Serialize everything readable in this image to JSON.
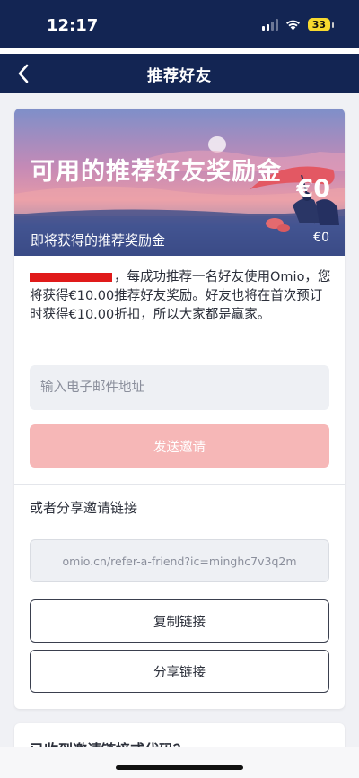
{
  "status_bar": {
    "time": "12:17",
    "battery": "33",
    "icons": [
      "signal-icon",
      "wifi-icon",
      "battery-icon"
    ]
  },
  "nav": {
    "title": "推荐好友",
    "back_icon": "chevron-left-icon"
  },
  "hero": {
    "title": "可用的推荐好友奖励金",
    "amount": "€0",
    "subtitle": "即将获得的推荐奖励金",
    "subamount": "€0"
  },
  "description": "，每成功推荐一名好友使用Omio，您将获得€10.00推荐好友奖励。好友也将在首次预订时获得€10.00折扣，所以大家都是赢家。",
  "email": {
    "placeholder": "输入电子邮件地址",
    "value": ""
  },
  "buttons": {
    "send": "发送邀请",
    "copy": "复制链接",
    "share": "分享链接"
  },
  "share_section": {
    "label": "或者分享邀请链接",
    "link": "omio.cn/refer-a-friend?ic=minghc7v3q2m"
  },
  "next_card": {
    "title": "已收到邀请链接或代码？"
  },
  "colors": {
    "header": "#132553",
    "send_button_disabled": "#f6b7b7",
    "battery": "#f7d92e"
  }
}
